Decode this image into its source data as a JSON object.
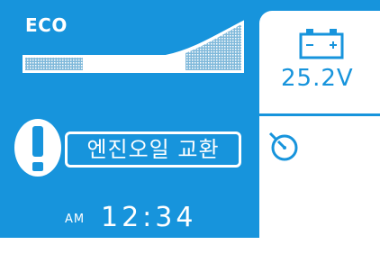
{
  "mode": {
    "label": "ECO",
    "eco_level": 0.6
  },
  "warning": {
    "message": "엔진오일 교환"
  },
  "clock": {
    "ampm": "AM",
    "time": "12:34"
  },
  "battery": {
    "voltage": "25.2V"
  },
  "icons": {
    "warning": "exclamation-icon",
    "battery": "battery-icon",
    "timer": "stopwatch-icon"
  },
  "colors": {
    "background": "#1794dc",
    "panel": "#ffffff",
    "text": "#ffffff"
  }
}
